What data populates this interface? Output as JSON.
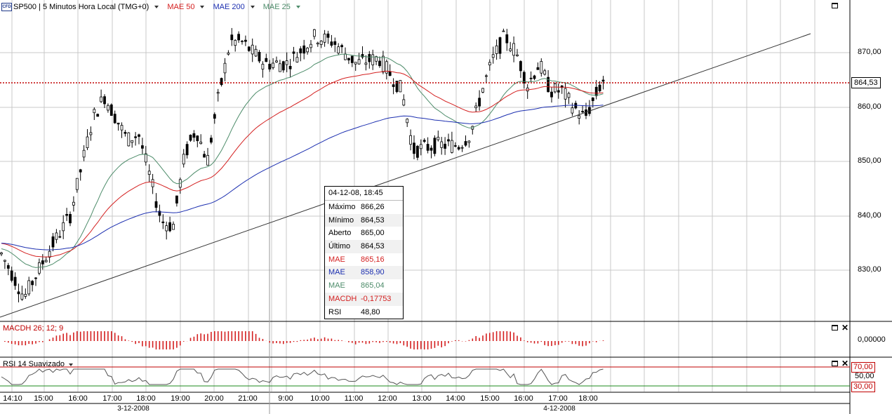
{
  "header": {
    "instrument": "SP500 | 5 Minutos Hora Local (TMG+0)",
    "icon_text": "CFD",
    "indicators": [
      {
        "label": "MAE 50",
        "color": "#d42020"
      },
      {
        "label": "MAE 200",
        "color": "#1c2fb0"
      },
      {
        "label": "MAE 25",
        "color": "#4d8c6a"
      }
    ]
  },
  "price_axis": {
    "labels": [
      "870,00",
      "860,00",
      "850,00",
      "840,00",
      "830,00"
    ],
    "current_price": "864,53"
  },
  "tooltip": {
    "title": "04-12-08, 18:45",
    "rows": [
      {
        "label": "Máximo",
        "value": "866,26",
        "color": "#000000"
      },
      {
        "label": "Mínimo",
        "value": "864,53",
        "color": "#000000"
      },
      {
        "label": "Aberto",
        "value": "865,00",
        "color": "#000000"
      },
      {
        "label": "Último",
        "value": "864,53",
        "color": "#000000"
      },
      {
        "label": "MAE",
        "value": "865,16",
        "color": "#d42020"
      },
      {
        "label": "MAE",
        "value": "858,90",
        "color": "#1c2fb0"
      },
      {
        "label": "MAE",
        "value": "865,04",
        "color": "#4d8c6a"
      },
      {
        "label": "MACDH",
        "value": "-0,17753",
        "color": "#d42020"
      },
      {
        "label": "RSI",
        "value": "48,80",
        "color": "#000000"
      }
    ]
  },
  "macd_panel": {
    "label": "MACDH 26; 12; 9",
    "axis_label": "0,00000",
    "color": "#d42020"
  },
  "rsi_panel": {
    "label": "RSI 14 Suavizado",
    "level_high": "70,00",
    "level_mid": "50,00",
    "level_low": "30,00",
    "high_color": "#c00000",
    "low_color": "#1c8a1c"
  },
  "time_axis": {
    "labels": [
      "14:10",
      "15:00",
      "16:00",
      "17:00",
      "18:00",
      "19:00",
      "20:00",
      "21:00",
      "9:00",
      "10:00",
      "11:00",
      "12:00",
      "13:00",
      "14:00",
      "15:00",
      "16:00",
      "17:00",
      "18:00"
    ],
    "dates": [
      "3-12-2008",
      "4-12-2008"
    ]
  }
}
